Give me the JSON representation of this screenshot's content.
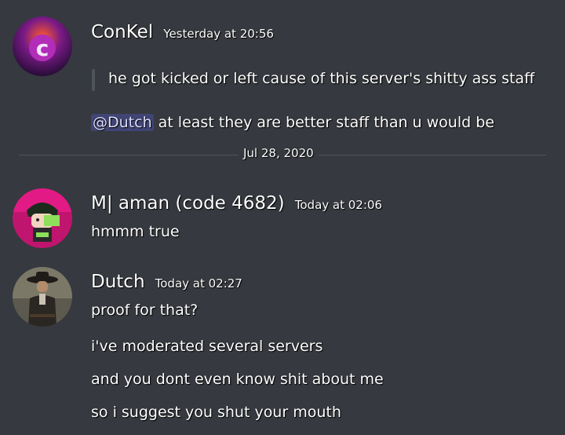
{
  "messages": [
    {
      "username": "ConKel",
      "timestamp": "Yesterday at 20:56",
      "quote": "he got kicked or left cause of this server's shitty ass staff",
      "reply_mention": "@Dutch",
      "reply_text": " at least they are better staff than u would be"
    },
    {
      "username": "M| aman (code 4682)",
      "timestamp": "Today at 02:06",
      "lines": [
        "hmmm true"
      ]
    },
    {
      "username": "Dutch",
      "timestamp": "Today at 02:27",
      "lines": [
        "proof for that?",
        "i've moderated several servers",
        "and you dont even know shit about me",
        "so i suggest you shut your mouth"
      ]
    }
  ],
  "date_divider": "Jul 28, 2020",
  "avatar_icons": [
    "conkel-c-logo-icon",
    "aman-anime-character-icon",
    "dutch-cowboy-icon"
  ],
  "colors": {
    "background": "#36393f",
    "mention_bg": "#5865f24d",
    "divider": "#4f545c"
  }
}
